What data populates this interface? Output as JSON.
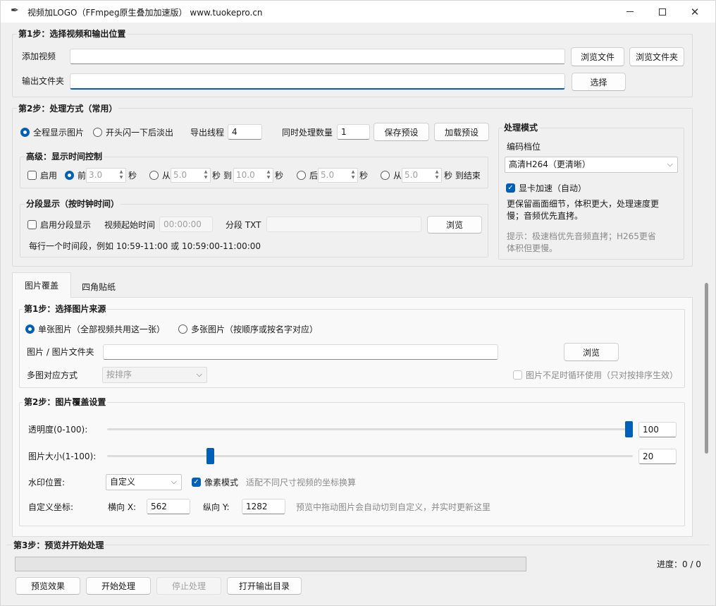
{
  "window": {
    "title": "视频加LOGO（FFmpeg原生叠加加速版）  www.tuokepro.cn"
  },
  "step1": {
    "title": "第1步：选择视频和输出位置",
    "add_video_label": "添加视频",
    "add_video_value": "",
    "output_folder_label": "输出文件夹",
    "output_folder_value": "",
    "browse_file": "浏览文件",
    "browse_folder": "浏览文件夹",
    "select": "选择"
  },
  "step2": {
    "title": "第2步：处理方式（常用）",
    "radio_full": "全程显示图片",
    "radio_flash": "开头闪一下后淡出",
    "export_threads_label": "导出线程",
    "export_threads_value": "4",
    "concurrent_label": "同时处理数量",
    "concurrent_value": "1",
    "save_preset": "保存预设",
    "load_preset": "加载预设",
    "advanced": {
      "title": "高级：显示时间控制",
      "enable": "启用",
      "before": "前",
      "before_val": "3.0",
      "sec": "秒",
      "from": "从",
      "from_val": "5.0",
      "to": "秒 到",
      "to_val": "10.0",
      "after": "后",
      "after_val": "5.0",
      "from2": "从",
      "from2_val": "5.0",
      "to_end": "秒 到结束"
    },
    "segment": {
      "title": "分段显示（按时钟时间）",
      "enable": "启用分段显示",
      "start_label": "视频起始时间",
      "start_val": "00:00:00",
      "txt_label": "分段 TXT",
      "txt_val": "",
      "browse": "浏览",
      "hint": "每行一个时间段，例如 10:59-11:00 或 10:59:00-11:00:00"
    },
    "mode": {
      "title": "处理模式",
      "encode_label": "编码档位",
      "encode_value": "高清H264（更清晰）",
      "gpu_label": "显卡加速（自动）",
      "desc": "更保留画面细节，体积更大，处理速度更慢；音频优先直拷。",
      "tip": "提示：极速档优先音频直拷；H265更省体积但更慢。"
    }
  },
  "tabs": [
    "图片覆盖",
    "四角贴纸"
  ],
  "img_step1": {
    "title": "第1步：选择图片来源",
    "single": "单张图片（全部视频共用这一张）",
    "multi": "多张图片（按顺序或按名字对应）",
    "path_label": "图片 / 图片文件夹",
    "path_value": "",
    "browse": "浏览",
    "map_label": "多图对应方式",
    "map_value": "按排序",
    "loop_label": "图片不足时循环使用（只对按排序生效）"
  },
  "img_step2": {
    "title": "第2步：图片覆盖设置",
    "opacity_label": "透明度(0-100):",
    "opacity_value": "100",
    "opacity_level": 100,
    "size_label": "图片大小(1-100):",
    "size_value": "20",
    "size_level": 20,
    "pos_label": "水印位置:",
    "pos_value": "自定义",
    "pixel_mode": "像素模式",
    "pixel_hint": "适配不同尺寸视频的坐标换算",
    "coord_label": "自定义坐标:",
    "x_label": "横向 X:",
    "x_value": "562",
    "y_label": "纵向 Y:",
    "y_value": "1282",
    "coord_hint": "预览中拖动图片会自动切到自定义，并实时更新这里"
  },
  "step3": {
    "title": "第3步：预览并开始处理",
    "progress_label": "进度：0 / 0",
    "progress": 0,
    "preview": "预览效果",
    "start": "开始处理",
    "stop": "停止处理",
    "open_output": "打开输出目录"
  },
  "colors": {
    "accent": "#005fb8"
  }
}
